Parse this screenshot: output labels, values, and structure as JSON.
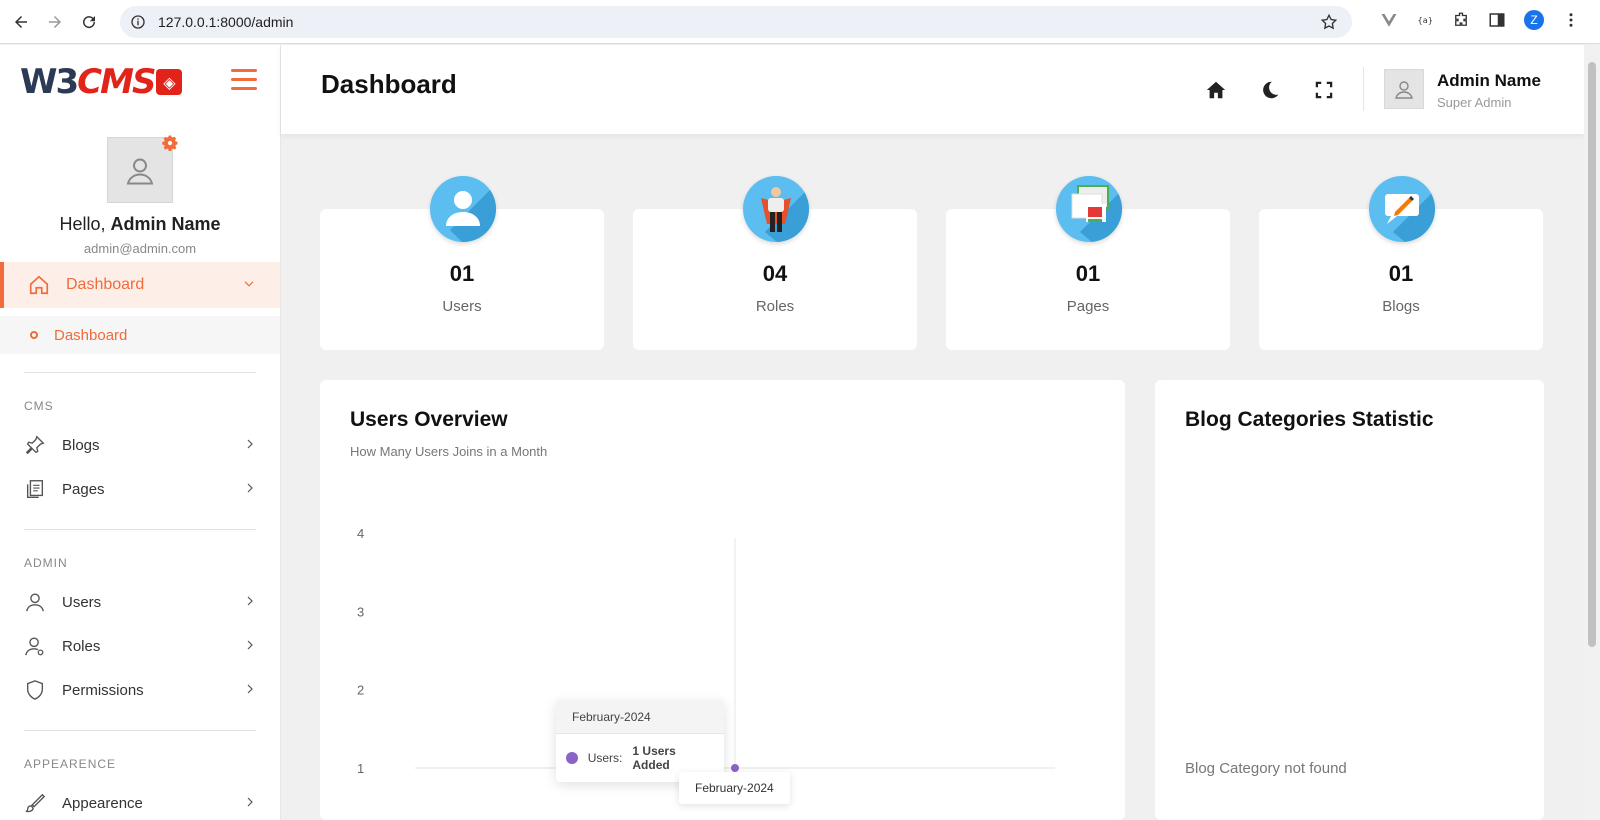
{
  "browser": {
    "url": "127.0.0.1:8000/admin",
    "profile_initial": "Z"
  },
  "sidebar": {
    "logo_left": "W3",
    "logo_right": "CMS",
    "hello_prefix": "Hello, ",
    "user_name": "Admin Name",
    "email": "admin@admin.com",
    "active_menu": "Dashboard",
    "active_sub": "Dashboard",
    "sections": [
      {
        "title": "CMS",
        "items": [
          {
            "label": "Blogs",
            "icon": "pin-icon"
          },
          {
            "label": "Pages",
            "icon": "pages-icon"
          }
        ]
      },
      {
        "title": "ADMIN",
        "items": [
          {
            "label": "Users",
            "icon": "user-icon"
          },
          {
            "label": "Roles",
            "icon": "user-role-icon"
          },
          {
            "label": "Permissions",
            "icon": "shield-icon"
          }
        ]
      },
      {
        "title": "APPEARENCE",
        "items": [
          {
            "label": "Appearence",
            "icon": "brush-icon"
          }
        ]
      }
    ]
  },
  "header": {
    "title": "Dashboard",
    "user_name": "Admin Name",
    "user_role": "Super Admin"
  },
  "stats": [
    {
      "value": "01",
      "label": "Users",
      "icon": "users-stat-icon"
    },
    {
      "value": "04",
      "label": "Roles",
      "icon": "roles-stat-icon"
    },
    {
      "value": "01",
      "label": "Pages",
      "icon": "pages-stat-icon"
    },
    {
      "value": "01",
      "label": "Blogs",
      "icon": "blogs-stat-icon"
    }
  ],
  "users_overview": {
    "title": "Users Overview",
    "subtitle": "How Many Users Joins in a Month",
    "tooltip_title": "February-2024",
    "tooltip_series": "Users:",
    "tooltip_value": "1 Users Added",
    "x_tooltip": "February-2024"
  },
  "blog_categories": {
    "title": "Blog Categories Statistic",
    "empty_message": "Blog Category not found"
  },
  "chart_data": {
    "type": "line",
    "categories": [
      "February-2024"
    ],
    "series": [
      {
        "name": "Users",
        "values": [
          1
        ]
      }
    ],
    "yticks": [
      "1",
      "2",
      "3",
      "4"
    ],
    "ylim": [
      1,
      4
    ],
    "color": "#8c64c8",
    "grid": false
  },
  "colors": {
    "accent": "#f26b3a",
    "stat_icon_bg": "#5bbdf0"
  }
}
